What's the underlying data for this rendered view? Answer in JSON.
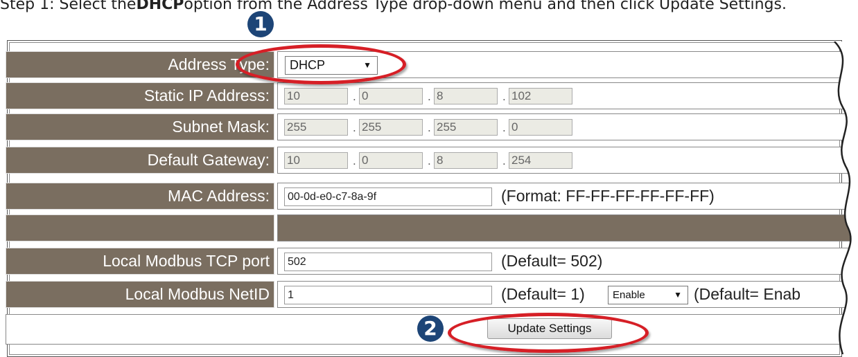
{
  "caption": {
    "prefix": "Step 1: Select the ",
    "bold": "DHCP",
    "suffix": " option from the Address Type drop-down menu and then click Update Settings."
  },
  "markers": {
    "first": "1",
    "second": "2"
  },
  "address_type": {
    "label": "Address Type:",
    "selected": "DHCP"
  },
  "static_ip": {
    "label": "Static IP Address:",
    "octets": [
      "10",
      "0",
      "8",
      "102"
    ]
  },
  "subnet_mask": {
    "label": "Subnet Mask:",
    "octets": [
      "255",
      "255",
      "255",
      "0"
    ]
  },
  "default_gateway": {
    "label": "Default Gateway:",
    "octets": [
      "10",
      "0",
      "8",
      "254"
    ]
  },
  "mac_address": {
    "label": "MAC Address:",
    "value": "00-0d-e0-c7-8a-9f",
    "hint": "(Format: FF-FF-FF-FF-FF-FF)"
  },
  "modbus_port": {
    "label": "Local Modbus TCP port",
    "value": "502",
    "hint": "(Default= 502)"
  },
  "modbus_netid": {
    "label": "Local Modbus NetID",
    "value": "1",
    "hint": "(Default= 1)",
    "select_value": "Enable",
    "select_hint": "(Default= Enab"
  },
  "update_button": {
    "label": "Update Settings"
  },
  "colors": {
    "label_bg": "#7a6e60",
    "highlight": "#d61f26",
    "marker": "#1d4577"
  }
}
